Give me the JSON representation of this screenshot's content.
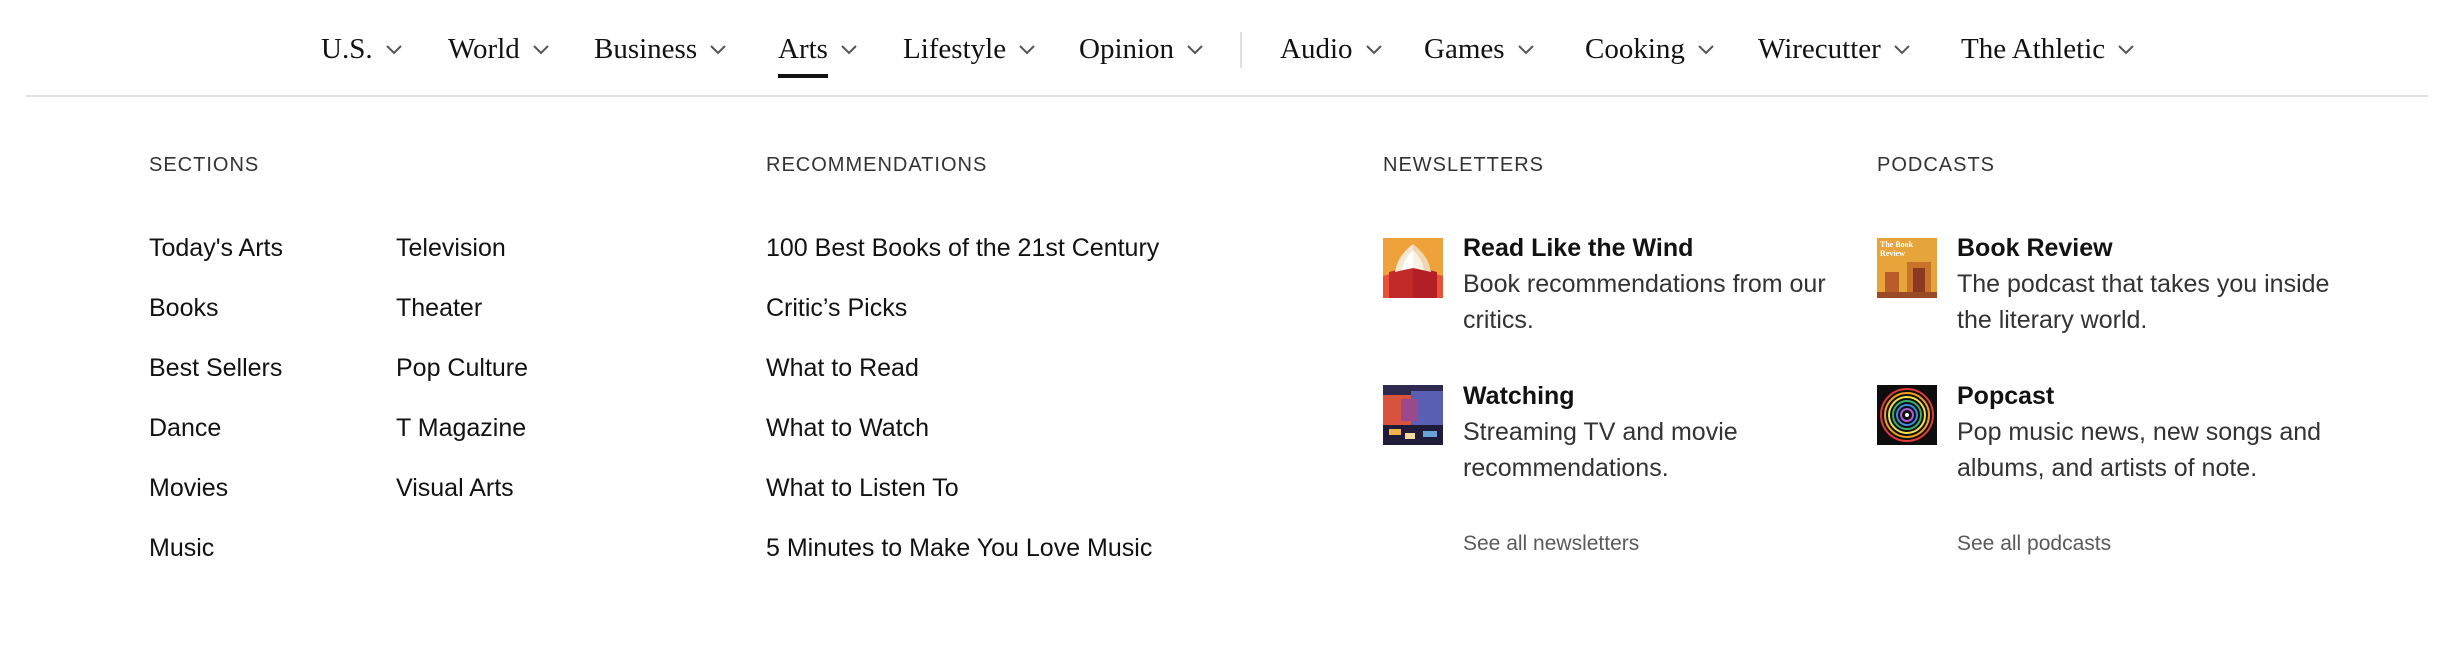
{
  "nav": {
    "items": [
      {
        "label": "U.S."
      },
      {
        "label": "World"
      },
      {
        "label": "Business"
      },
      {
        "label": "Arts",
        "active": true
      },
      {
        "label": "Lifestyle"
      },
      {
        "label": "Opinion"
      },
      {
        "label": "Audio"
      },
      {
        "label": "Games"
      },
      {
        "label": "Cooking"
      },
      {
        "label": "Wirecutter"
      },
      {
        "label": "The Athletic"
      }
    ]
  },
  "sections": {
    "heading": "SECTIONS",
    "col1": [
      "Today's Arts",
      "Books",
      "Best Sellers",
      "Dance",
      "Movies",
      "Music"
    ],
    "col2": [
      "Television",
      "Theater",
      "Pop Culture",
      "T Magazine",
      "Visual Arts"
    ]
  },
  "recommendations": {
    "heading": "RECOMMENDATIONS",
    "items": [
      "100 Best Books of the 21st Century",
      "Critic’s Picks",
      "What to Read",
      "What to Watch",
      "What to Listen To",
      "5 Minutes to Make You Love Music"
    ]
  },
  "newsletters": {
    "heading": "NEWSLETTERS",
    "items": [
      {
        "title": "Read Like the Wind",
        "desc": "Book recommendations from our critics.",
        "icon": "book-newsletter-icon"
      },
      {
        "title": "Watching",
        "desc": "Streaming TV and movie recommendations.",
        "icon": "tv-newsletter-icon"
      }
    ],
    "see_all": "See all newsletters"
  },
  "podcasts": {
    "heading": "PODCASTS",
    "items": [
      {
        "title": "Book Review",
        "desc": "The podcast that takes you inside the literary world.",
        "icon": "book-review-podcast-icon",
        "cover_text": "The Book Review"
      },
      {
        "title": "Popcast",
        "desc": "Pop music news, new songs and albums, and artists of note.",
        "icon": "popcast-podcast-icon"
      }
    ],
    "see_all": "See all podcasts"
  },
  "colors": {
    "text": "#121212",
    "muted": "#5a5a5a",
    "rule": "#e2e2e2"
  }
}
